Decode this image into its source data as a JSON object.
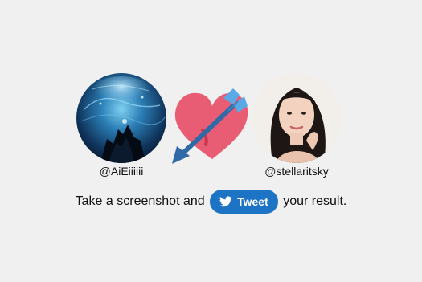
{
  "profiles": {
    "left": {
      "handle": "@AiEiiiiii",
      "avatar": "avatar-fantasy-blue-scene"
    },
    "right": {
      "handle": "@stellaritsky",
      "avatar": "avatar-woman-portrait"
    }
  },
  "center_icon": "heart-with-arrow-icon",
  "cta": {
    "prefix": "Take a screenshot and",
    "button_label": "Tweet",
    "suffix": "your result."
  },
  "colors": {
    "background": "#f0f0f0",
    "tweet_button": "#1d73c4",
    "heart": "#e85c74",
    "arrow": "#2f6aa6",
    "fletching": "#5aa9e6"
  },
  "icons": {
    "tweet_button": "twitter-bird-icon"
  }
}
